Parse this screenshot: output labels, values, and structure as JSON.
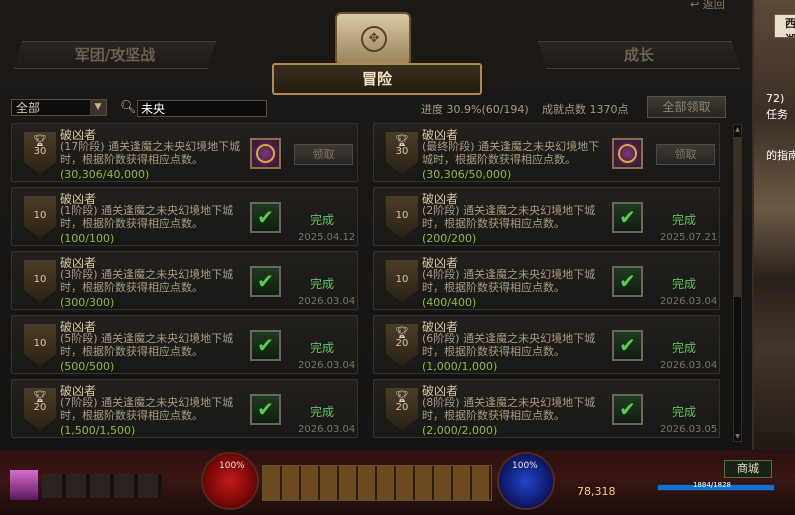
{
  "header": {
    "back_label": "返回",
    "tab_left": "军团/攻坚战",
    "tab_right": "成长",
    "tab_active": "冒险"
  },
  "toolbar": {
    "filter_value": "全部",
    "search_value": "未央",
    "progress_label": "进度 30.9%(60/194)",
    "points_label": "成就点数 1370点",
    "claim_all_label": "全部领取"
  },
  "cards": [
    {
      "name": "破凶者",
      "desc": "(17阶段) 通关逢魔之未央幻境地下城时，根据阶数获得相应点数。",
      "prog": "(30,306/40,000)",
      "points": "30",
      "state": "claim",
      "claim_label": "领取",
      "date": ""
    },
    {
      "name": "破凶者",
      "desc": "(最终阶段) 通关逢魔之未央幻境地下城时，根据阶数获得相应点数。",
      "prog": "(30,306/50,000)",
      "points": "30",
      "state": "claim",
      "claim_label": "领取",
      "date": ""
    },
    {
      "name": "破凶者",
      "desc": "(1阶段) 通关逢魔之未央幻境地下城时，根据阶数获得相应点数。",
      "prog": "(100/100)",
      "points": "10",
      "state": "done",
      "done_label": "完成",
      "date": "2025.04.12"
    },
    {
      "name": "破凶者",
      "desc": "(2阶段) 通关逢魔之未央幻境地下城时，根据阶数获得相应点数。",
      "prog": "(200/200)",
      "points": "10",
      "state": "done",
      "done_label": "完成",
      "date": "2025.07.21"
    },
    {
      "name": "破凶者",
      "desc": "(3阶段) 通关逢魔之未央幻境地下城时，根据阶数获得相应点数。",
      "prog": "(300/300)",
      "points": "10",
      "state": "done",
      "done_label": "完成",
      "date": "2026.03.04"
    },
    {
      "name": "破凶者",
      "desc": "(4阶段) 通关逢魔之未央幻境地下城时，根据阶数获得相应点数。",
      "prog": "(400/400)",
      "points": "10",
      "state": "done",
      "done_label": "完成",
      "date": "2026.03.04"
    },
    {
      "name": "破凶者",
      "desc": "(5阶段) 通关逢魔之未央幻境地下城时，根据阶数获得相应点数。",
      "prog": "(500/500)",
      "points": "10",
      "state": "done",
      "done_label": "完成",
      "date": "2026.03.04"
    },
    {
      "name": "破凶者",
      "desc": "(6阶段) 通关逢魔之未央幻境地下城时，根据阶数获得相应点数。",
      "prog": "(1,000/1,000)",
      "points": "20",
      "state": "done",
      "done_label": "完成",
      "date": "2026.03.04"
    },
    {
      "name": "破凶者",
      "desc": "(7阶段) 通关逢魔之未央幻境地下城时，根据阶数获得相应点数。",
      "prog": "(1,500/1,500)",
      "points": "20",
      "state": "done",
      "done_label": "完成",
      "date": "2026.03.04"
    },
    {
      "name": "破凶者",
      "desc": "(8阶段) 通关逢魔之未央幻境地下城时，根据阶数获得相应点数。",
      "prog": "(2,000/2,000)",
      "points": "20",
      "state": "done",
      "done_label": "完成",
      "date": "2026.03.05"
    }
  ],
  "hud": {
    "hp_pct": "100%",
    "mp_pct": "100%",
    "gold": "78,318",
    "shop_label": "商城",
    "xp_text": "1884/1828"
  },
  "side": {
    "badge": "西湖",
    "lines": [
      "72)",
      "任务",
      "的指南"
    ]
  },
  "colors": {
    "accent_gold": "#b08a52",
    "done_green": "#61c35b",
    "progress_green": "#8db845"
  }
}
